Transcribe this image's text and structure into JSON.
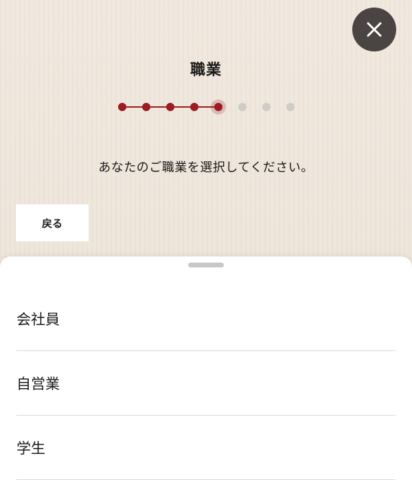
{
  "header": {
    "title": "職業",
    "close_icon": "close-icon"
  },
  "stepper": {
    "total_steps": 8,
    "current_step": 5,
    "active_color": "#9b1c23",
    "inactive_color": "#cfcbc7"
  },
  "instruction": "あなたのご職業を選択してください。",
  "back_button": {
    "label": "戻る"
  },
  "sheet": {
    "options": [
      {
        "label": "会社員"
      },
      {
        "label": "自営業"
      },
      {
        "label": "学生"
      }
    ]
  },
  "colors": {
    "close_button_bg": "#4a4542",
    "accent": "#9b1c23"
  }
}
